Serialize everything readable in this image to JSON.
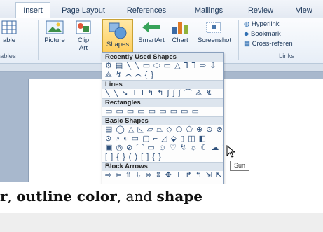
{
  "tabs": [
    "Insert",
    "Page Layout",
    "References",
    "Mailings",
    "Review",
    "View"
  ],
  "ribbon": {
    "partial_left_button": "able",
    "partial_left_group": "ables",
    "picture": "Picture",
    "clipart": "Clip Art",
    "shapes": "Shapes",
    "smartart": "SmartArt",
    "chart": "Chart",
    "screenshot": "Screenshot",
    "hyperlink": "Hyperlink",
    "bookmark": "Bookmark",
    "crossref": "Cross-referen",
    "links_group": "Links"
  },
  "gallery": {
    "sections": [
      {
        "title": "Recently Used Shapes",
        "rows": [
          "⚙ ▤ ╲ ╲ ▭ ⬭ ▭ △ ⅂ ⅂ ⇨ ⇩",
          "⟁ ↯ ⌒ ⌒ { }"
        ]
      },
      {
        "title": "Lines",
        "rows": [
          "╲ ╲ ↘ ⅂ ⅂ ↰ ↰ ∫ ∫ ∫ ⌒ ⟁ ↯"
        ]
      },
      {
        "title": "Rectangles",
        "rows": [
          "▭ ▭ ▭ ▭ ▭ ▭ ▭ ▭ ▭"
        ]
      },
      {
        "title": "Basic Shapes",
        "rows": [
          "▤ ◯ △ ◺ ▱ ⏢ ◇ ⬡ ⬠ ⊕ ⊙ ⊗",
          "⊙ ◔ ◐ ▭ ▢ ⌐ ◿ ⬙ ▯ ◫ ◧",
          "▣ ◎ ⊘ ⌒ ▭ ☺ ♡ ↯ ☼ ☾ ☁ ⌒",
          "[ ] { } ( ) [ ] { }"
        ]
      },
      {
        "title": "Block Arrows",
        "rows": [
          "⇨ ⇦ ⇧ ⇩ ⬄ ⇕ ✥ ⊥ ↱ ↰ ⇲ ⇱"
        ]
      }
    ]
  },
  "tooltip": "Sun",
  "caption": {
    "part1": "r",
    "sep1": ", ",
    "part2": "outline color",
    "sep2": ", and ",
    "part3": "shape"
  },
  "colors": {
    "accent": "#ffcd5a",
    "ribbon": "#e7eef7",
    "tab_text": "#1e395b"
  }
}
